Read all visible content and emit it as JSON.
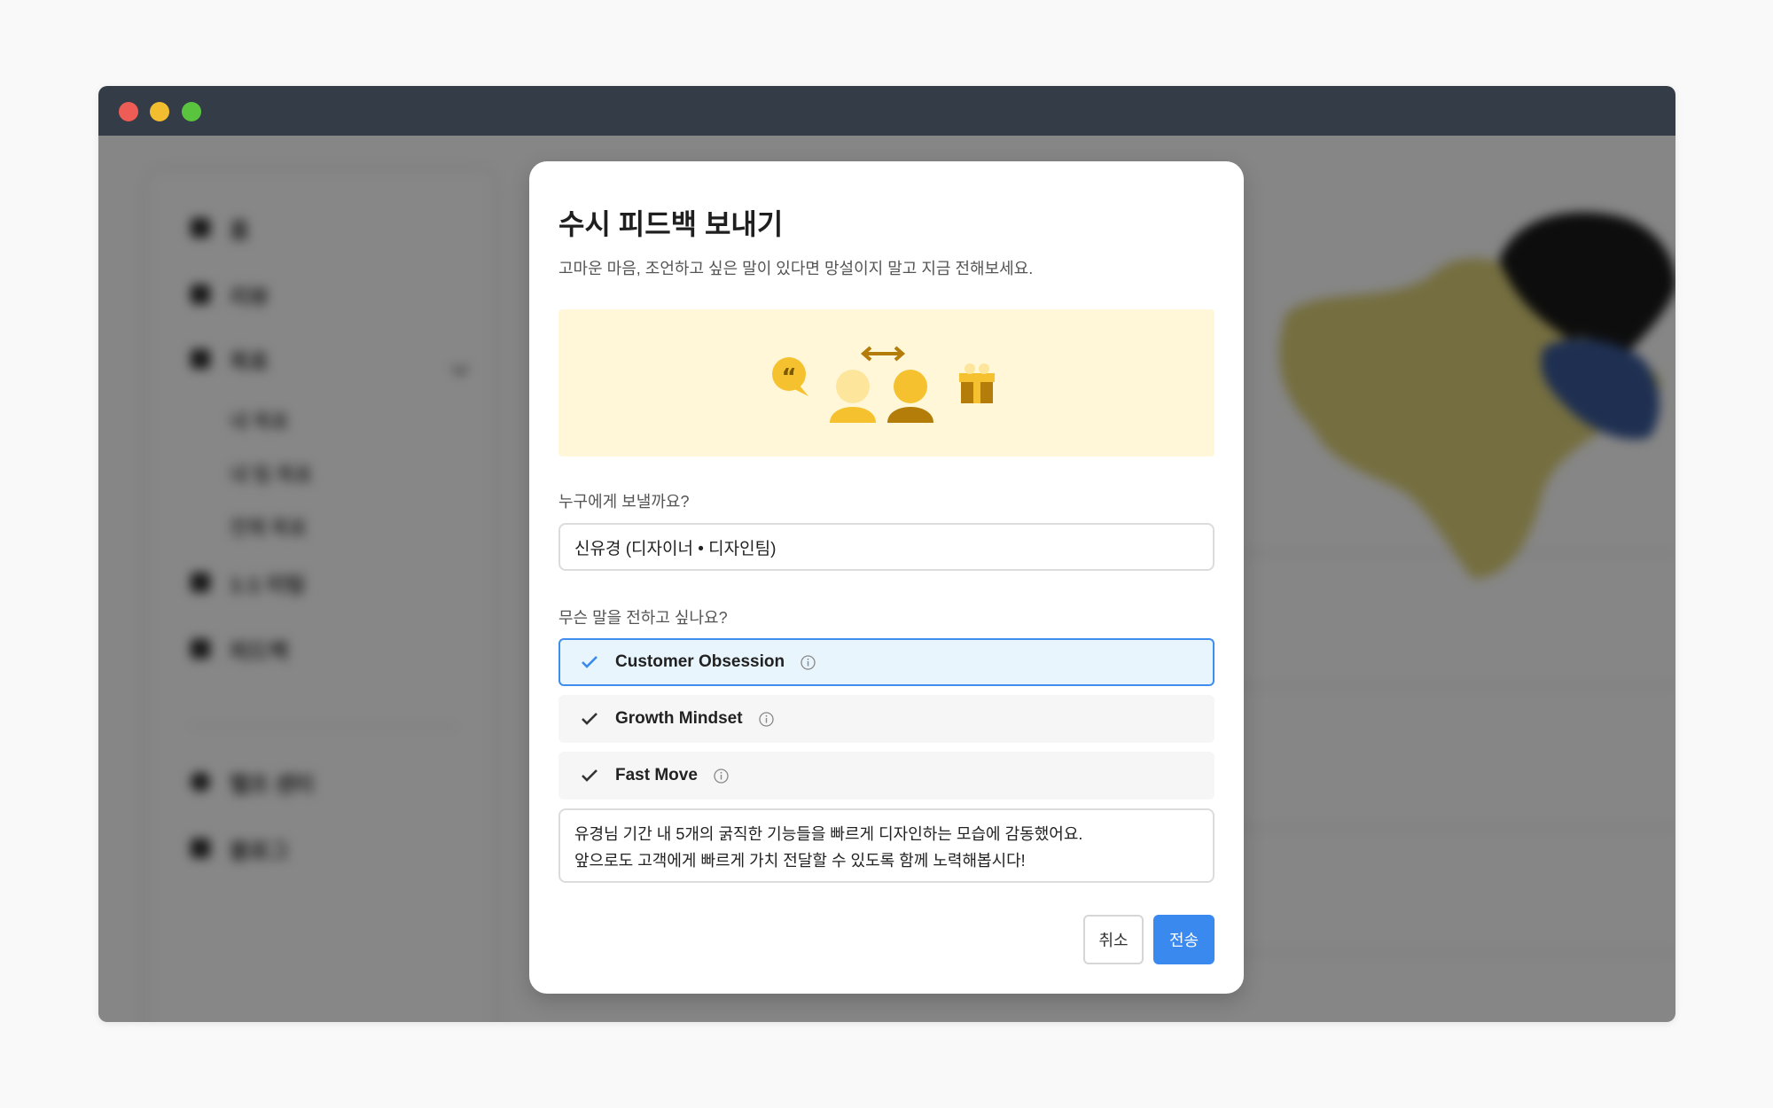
{
  "modal": {
    "title": "수시 피드백 보내기",
    "description": "고마운 마음, 조언하고 싶은 말이 있다면 망설이지 말고 지금 전해보세요.",
    "recipient_label": "누구에게 보낼까요?",
    "recipient_value": "신유경 (디자이너 • 디자인팀)",
    "message_label": "무슨 말을 전하고 싶나요?",
    "values": [
      {
        "label": "Customer Obsession",
        "selected": true
      },
      {
        "label": "Growth Mindset",
        "selected": false
      },
      {
        "label": "Fast Move",
        "selected": false
      }
    ],
    "message_lines": [
      "유경님 기간 내 5개의 굵직한 기능들을 빠르게 디자인하는 모습에 감동했어요.",
      "앞으로도 고객에게 빠르게 가치 전달할 수 있도록 함께 노력해봅시다!"
    ],
    "cancel_label": "취소",
    "send_label": "전송"
  },
  "sidebar": {
    "items": [
      "홈",
      "리뷰",
      "목표",
      "1:1 미팅",
      "피드백",
      "헬프 센터",
      "블로그"
    ],
    "sub_items": [
      "내 목표",
      "내 팀 목표",
      "전체 목표"
    ]
  },
  "colors": {
    "accent": "#3a89ef",
    "selected_bg": "#e8f5fd",
    "banner_bg": "#fff7d8",
    "titlebar": "#343c48"
  }
}
